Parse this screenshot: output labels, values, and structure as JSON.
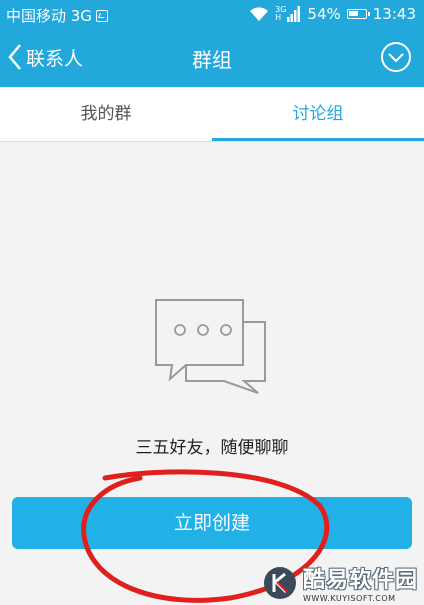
{
  "status_bar": {
    "carrier": "中国移动 3G",
    "network_tag_top": "3G",
    "network_tag_bottom": "H",
    "battery": "54%",
    "time": "13:43"
  },
  "header": {
    "back_label": "联系人",
    "title": "群组"
  },
  "tabs": [
    {
      "label": "我的群",
      "active": false
    },
    {
      "label": "讨论组",
      "active": true
    }
  ],
  "empty_state": {
    "message": "三五好友，随便聊聊",
    "button_label": "立即创建"
  },
  "watermark": {
    "name": "酷易软件园",
    "url": "WWW.KUYISOFT.COM"
  },
  "colors": {
    "accent": "#23a8dc",
    "button": "#22b1e6",
    "annotation": "#e0201e"
  }
}
